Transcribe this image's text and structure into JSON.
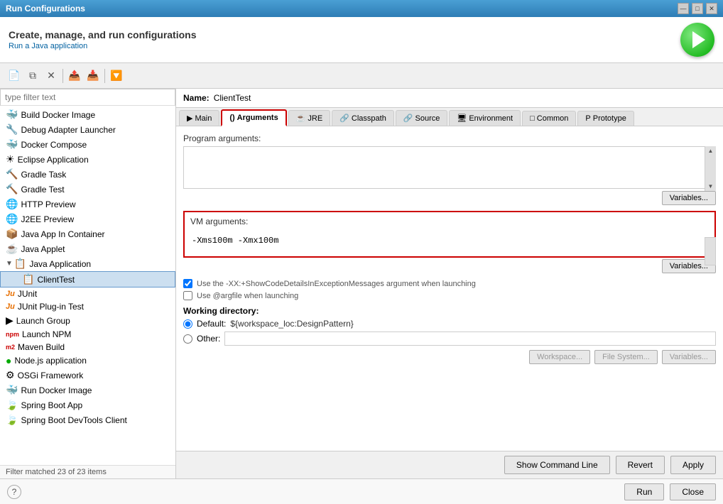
{
  "titleBar": {
    "title": "Run Configurations",
    "controls": [
      "minimize",
      "maximize",
      "close"
    ]
  },
  "header": {
    "title": "Create, manage, and run configurations",
    "subtitle": "Run a Java application"
  },
  "toolbar": {
    "buttons": [
      "new",
      "duplicate",
      "delete",
      "filter",
      "collapse"
    ]
  },
  "leftPanel": {
    "filterPlaceholder": "type filter text",
    "treeItems": [
      {
        "id": "build-docker",
        "label": "Build Docker Image",
        "icon": "🐳",
        "indent": 0
      },
      {
        "id": "debug-adapter",
        "label": "Debug Adapter Launcher",
        "icon": "🔧",
        "indent": 0
      },
      {
        "id": "docker-compose",
        "label": "Docker Compose",
        "icon": "🐳",
        "indent": 0
      },
      {
        "id": "eclipse-app",
        "label": "Eclipse Application",
        "icon": "⚙",
        "indent": 0
      },
      {
        "id": "gradle-task",
        "label": "Gradle Task",
        "icon": "🔨",
        "indent": 0
      },
      {
        "id": "gradle-test",
        "label": "Gradle Test",
        "icon": "🔨",
        "indent": 0
      },
      {
        "id": "http-preview",
        "label": "HTTP Preview",
        "icon": "🌐",
        "indent": 0
      },
      {
        "id": "j2ee-preview",
        "label": "J2EE Preview",
        "icon": "🌐",
        "indent": 0
      },
      {
        "id": "java-container",
        "label": "Java App In Container",
        "icon": "📦",
        "indent": 0
      },
      {
        "id": "java-applet",
        "label": "Java Applet",
        "icon": "☕",
        "indent": 0
      },
      {
        "id": "java-app",
        "label": "Java Application",
        "icon": "📋",
        "indent": 0,
        "expanded": true
      },
      {
        "id": "client-test",
        "label": "ClientTest",
        "icon": "📋",
        "indent": 1,
        "selected": true
      },
      {
        "id": "junit",
        "label": "JUnit",
        "icon": "Ju",
        "indent": 0
      },
      {
        "id": "junit-plugin",
        "label": "JUnit Plug-in Test",
        "icon": "Ju",
        "indent": 0
      },
      {
        "id": "launch-group",
        "label": "Launch Group",
        "icon": "▶",
        "indent": 0
      },
      {
        "id": "launch-npm",
        "label": "Launch NPM",
        "icon": "npm",
        "indent": 0
      },
      {
        "id": "maven-build",
        "label": "Maven Build",
        "icon": "m2",
        "indent": 0
      },
      {
        "id": "nodejs",
        "label": "Node.js application",
        "icon": "🟢",
        "indent": 0
      },
      {
        "id": "osgi",
        "label": "OSGi Framework",
        "icon": "⚙",
        "indent": 0
      },
      {
        "id": "run-docker",
        "label": "Run Docker Image",
        "icon": "🐳",
        "indent": 0
      },
      {
        "id": "spring-boot",
        "label": "Spring Boot App",
        "icon": "🍃",
        "indent": 0
      },
      {
        "id": "spring-devtools",
        "label": "Spring Boot DevTools Client",
        "icon": "🍃",
        "indent": 0
      }
    ],
    "filterStatus": "Filter matched 23 of 23 items"
  },
  "rightPanel": {
    "name": {
      "label": "Name:",
      "value": "ClientTest"
    },
    "tabs": [
      {
        "id": "main",
        "label": "Main",
        "icon": "▶"
      },
      {
        "id": "arguments",
        "label": "Arguments",
        "icon": "()=",
        "active": true
      },
      {
        "id": "jre",
        "label": "JRE",
        "icon": "☕"
      },
      {
        "id": "classpath",
        "label": "Classpath",
        "icon": "📎"
      },
      {
        "id": "source",
        "label": "Source",
        "icon": "📎"
      },
      {
        "id": "environment",
        "label": "Environment",
        "icon": "🖥"
      },
      {
        "id": "common",
        "label": "Common",
        "icon": "□"
      },
      {
        "id": "prototype",
        "label": "Prototype",
        "icon": "P"
      }
    ],
    "config": {
      "programArgs": {
        "label": "Program arguments:",
        "value": "",
        "variablesBtn": "Variables..."
      },
      "vmArgs": {
        "label": "VM arguments:",
        "value": "-Xms100m -Xmx100m",
        "variablesBtn": "Variables..."
      },
      "checkboxShowCode": {
        "label": "Use the -XX:+ShowCodeDetailsInExceptionMessages argument when launching",
        "checked": true
      },
      "checkboxArgFile": {
        "label": "Use @argfile when launching",
        "checked": false
      },
      "workingDir": {
        "label": "Working directory:",
        "defaultLabel": "Default:",
        "defaultValue": "${workspace_loc:DesignPattern}",
        "otherLabel": "Other:",
        "buttons": {
          "workspace": "Workspace...",
          "fileSystem": "File System...",
          "variables": "Variables..."
        }
      }
    },
    "bottomButtons": {
      "showCommandLine": "Show Command Line",
      "revert": "Revert",
      "apply": "Apply"
    }
  },
  "footer": {
    "helpIcon": "?",
    "runBtn": "Run",
    "closeBtn": "Close"
  }
}
